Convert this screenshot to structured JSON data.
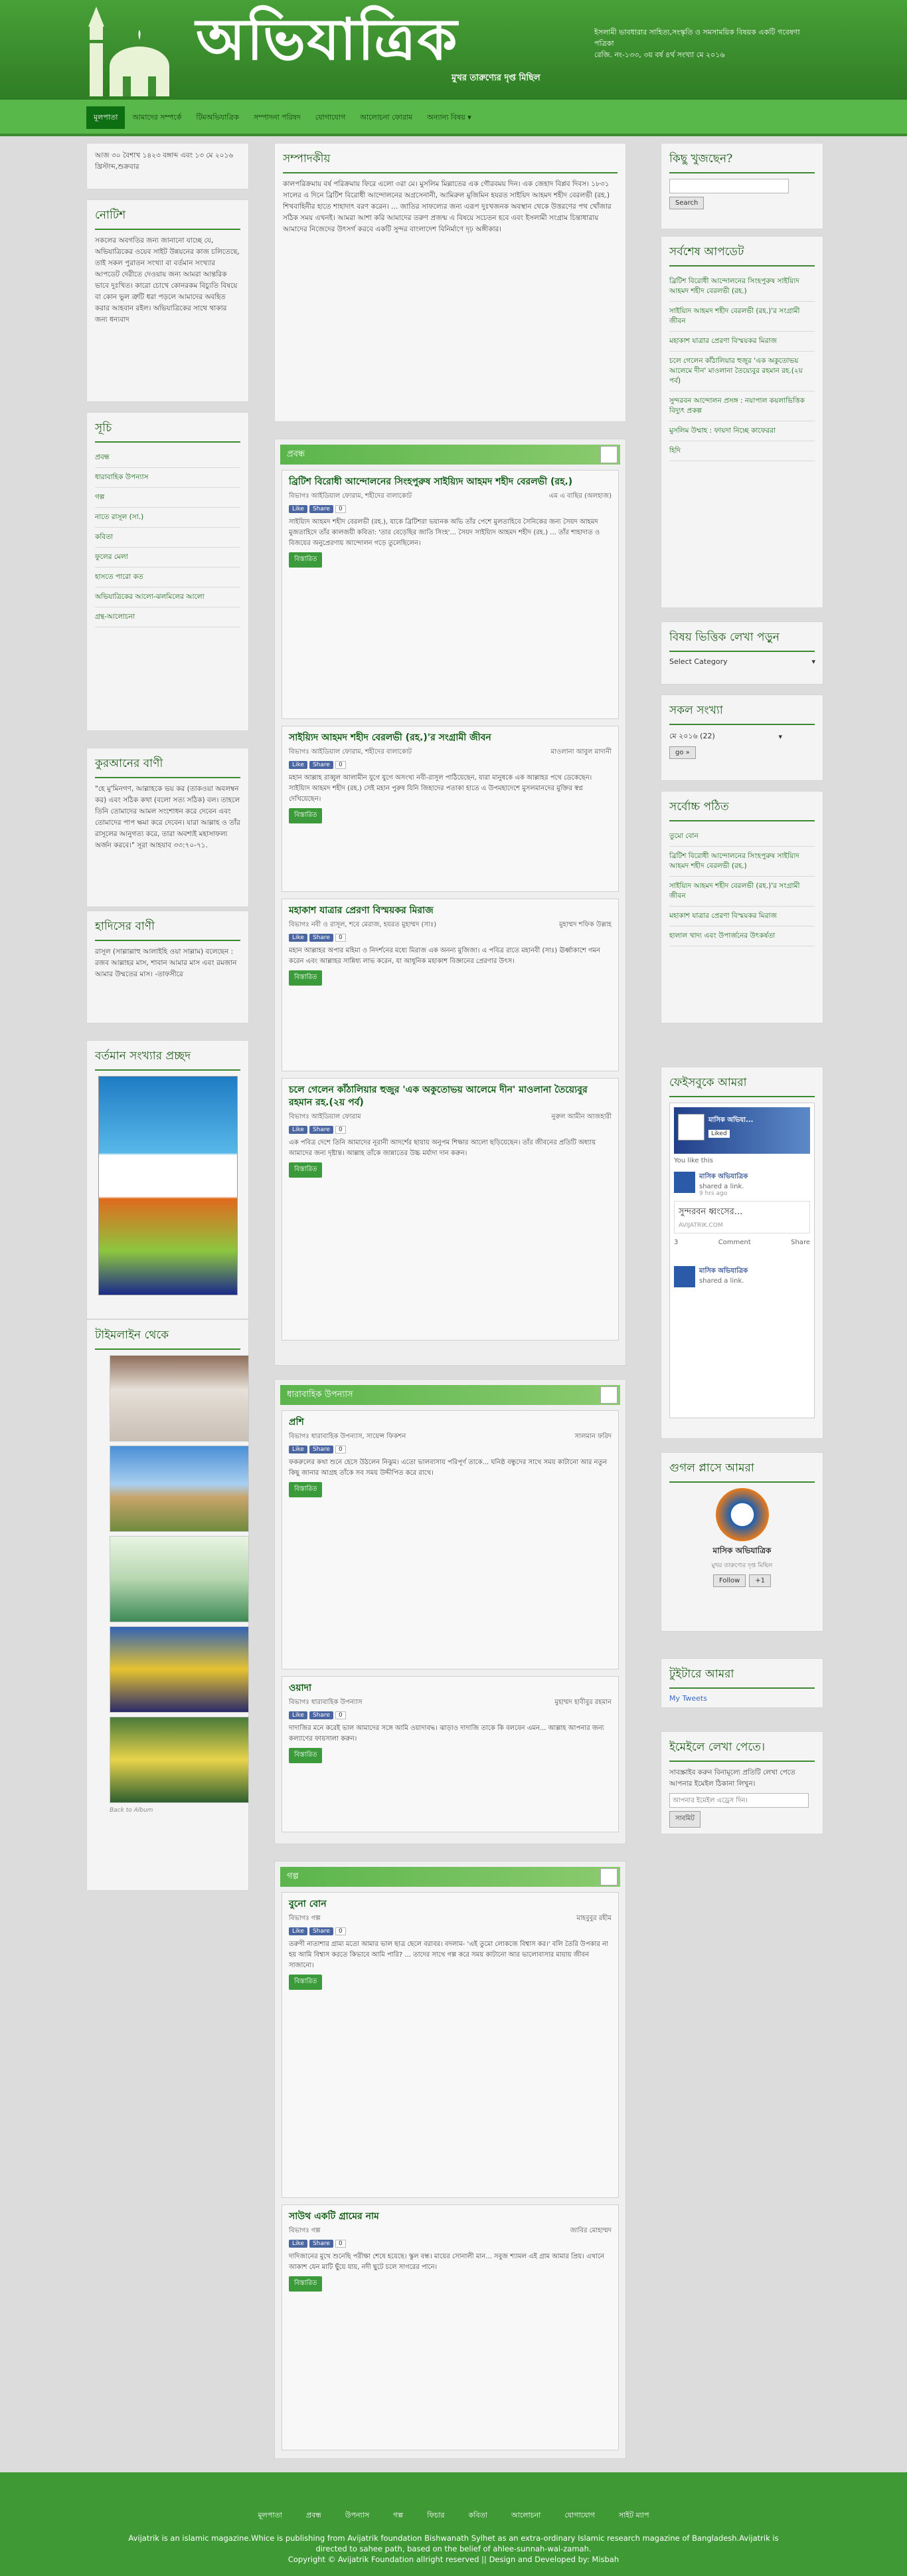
{
  "header": {
    "brand": "অভিযাত্রিক",
    "tagline": "মুখর তারুণ্যের দৃপ্ত মিছিল",
    "description": "ইসলামী ভাবধারার সাহিত্য,সংস্কৃতি ও সমসাময়িক বিষয়ক একটি গবেষণা পত্রিকা",
    "issue": "রেজি. নং-১৩৩, ৩য় বর্ষ ৪র্থ সংখ্যা মে ২০১৬"
  },
  "nav": {
    "items": [
      "মূলপাতা",
      "আমাদের সম্পর্কে",
      "টিমঅভিযাত্রিক",
      "সম্পাদনা পরিষদ",
      "যোগাযোগ",
      "আলোচনা ফোরাম",
      "অন্যান্য বিষয় ▾"
    ]
  },
  "left": {
    "date": "আজ ৩০ বৈশাখ ১৪২৩ বঙ্গাব্দ এবং ১৩ মে ২০১৬ খ্রিস্টাব্দ,শুক্রবার",
    "notice_title": "নোটিশ",
    "notice_text": "সকলের অবগতির জন্য জানানো যাচ্ছে যে, অভিযাত্রিকের ওয়েব সাইট উন্নয়নের কাজ চলিতেছে, তাই সকল পুরাতন সংখ্যা বা বর্তমান সংখ্যার আপডেট দেরীতে দেওয়ায় জন্য আমরা আন্তরিক ভাবে দুঃখিত। কারো চোখে কোনরকম বিচ্যুতি বিষয়ে বা কোন ভুল ত্রুটি ধরা পড়লে আমাদের অবহিত করার আহবান রইল। অভিযাত্রিকের সাথে থাকার জন্য ধন্যবাদ",
    "index_title": "সূচি",
    "index_items": [
      "প্রবন্ধ",
      "ধারাবাহিক উপন্যাস",
      "গল্প",
      "নাতে রাসূল (সা.)",
      "কবিতা",
      "ফুলের মেলা",
      "হাসতে পারো কত",
      "অভিযাত্রিকের আলো-ঝলমিলের আলো",
      "গ্রন্থ-আলোচনা"
    ],
    "quran_title": "কুরআনের বাণী",
    "quran_text": "\"হে মু'মিনগণ, আল্লাহকে ভয় কর (তাকওয়া অবলম্বন কর) এবং সঠিক কথা (বলো সত্য সঠিক) বল। তাহলে তিনি তোমাদের আমল সংশোধন করে দেবেন এবং তোমাদের পাপ ক্ষমা করে দেবেন। যারা আল্লাহ ও তাঁর রাসূলের আনুগত্য করে, তারা অবশ্যই মহাসাফল্য অর্জন করবে।\" সূরা আহযাব ৩৩:৭০-৭১.",
    "hadith_title": "হাদিসের বাণী",
    "hadith_text": "রাসূল (সাল্লাল্লাহু আলাইহি ওয়া সাল্লাম) বলেছেন : রজব আল্লাহর মাস, শাবান আমার মাস এবং রমজান আমার উম্মতের মাস। -তাফসীরে",
    "current_title": "বর্তমান সংখ্যার প্রচ্ছদ",
    "timeline_title": "টাইমলাইন থেকে",
    "back_to_album": "Back to Album"
  },
  "main": {
    "editorial_title": "সম্পাদকীয়",
    "editorial_text": "কালপরিক্রমায় বর্ষ পরিক্রমায় ফিরে এলো ৩রা মে। মুসলিম মিল্লাতের এক গৌরবময় দিন। এক জেহাদ বিপ্লব দিবস। ১৮৩১ সালের এ দিনে ব্রিটিশ বিরোধী আন্দোলনের অগ্রসেনানী, আমিরুল মুজিমিন হযরত সাইয়িদ আহমদ শহীদ বেরলভী (রহ.) শিখবাহিনীর হাতে শাহাদাৎ বরণ করেন। ... জাতির সাফল্যের জন্য এরূপ দুঃখজনক অবস্থান থেকে উত্তরণের পথ খোঁজার সঠিক সময় এখনই। আমরা আশা করি আমাদের তরুণ প্রজন্ম এ বিষয়ে সচেতন হবে এবং ইসলামী সংগ্রাম চিন্তাধারায় আমাদের নিজেদের উৎসর্গ করবে একটি সুন্দর বাংলাদেশ বিনির্মাণে দৃঢ় অঙ্গীকার।",
    "sections": [
      {
        "title": "প্রবন্ধ",
        "posts": [
          {
            "title": "ব্রিটিশ বিরোধী আন্দোলনের সিংহপুরুষ সাইয়্যিদ আহমদ শহীদ বেরলভী (রহ.)",
            "category": "বিভাগঃ আইডিয়াল ফোরাম, শহীদের বালাকোট",
            "author": "এম এ বাছির (অলহাজ)",
            "likes": "0",
            "excerpt": "সাইয়্যিদ আহমদ শহীদ বেরলভী (রহ.), যাকে ব্রিটিশরা ভয়ানক অভি তাঁর পেশে মুলতাহিবে সৈনিকের জন্য সৈয়দ আহমদ মুজতাহিদে তাঁর কালজয়ী কবিতা: 'তার বেড়েছির জাতি সিংহ'... সৈয়দ সাইয়্যিদ আহমদ শহীদ (রহ.) ... তাঁর শাহাদাত ও বিজয়ের অনুপ্রেরণায় আন্দোলন গড়ে তুলেছিলেন।",
            "more": "বিস্তারিত"
          },
          {
            "title": "সাইয়্যিদ আহমদ শহীদ বেরলভী (রহ.)'র সংগ্রামী জীবন",
            "category": "বিভাগঃ আইডিয়াল ফোরাম, শহীদের বালাকোট",
            "author": "মাওলানা আবুল মাদানী",
            "likes": "0",
            "excerpt": "মহান আল্লাহ রাব্বুল আলামীন যুগে যুগে অসংখ্য নবী-রাসূল পাঠিয়েছেন, যারা মানুষকে এক আল্লাহর পথে ডেকেছেন। সাইয়্যিদ আহমদ শহীদ (রহ.) সেই মহান পুরুষ যিনি জিহাদের পতাকা হাতে এ উপমহাদেশে মুসলমানদের মুক্তির স্বপ্ন দেখিয়েছেন।",
            "more": "বিস্তারিত"
          },
          {
            "title": "মহাকাশ যাত্রার প্রেরণা বিস্ময়কর মিরাজ",
            "category": "বিভাগঃ নবী ও রাসূল, শবে মেরাজ, হযরত মুহাম্মদ (সাঃ)",
            "author": "মুহাম্মদ শফিক উল্লাহ",
            "likes": "0",
            "excerpt": "মহান আল্লাহর অপার মহিমা ও নিদর্শনের মধ্যে মিরাজ এক অনন্য মুজিজা। এ পবিত্র রাতে মহানবী (সাঃ) ঊর্ধ্বাকাশে গমন করেন এবং আল্লাহর সান্নিধ্য লাভ করেন, যা আধুনিক মহাকাশ বিজ্ঞানের প্রেরণার উৎস।",
            "more": "বিস্তারিত"
          },
          {
            "title": "চলে গেলেন কাঁঠালিয়ার হুজুর 'এক অকুতোভয় আলেমে দীন' মাওলানা তৈয়্যেবুর রহমান রহ.(২য় পর্ব)",
            "category": "বিভাগঃ আইডিয়াল ফোরাম",
            "author": "নুরুল আমীন আজহারী",
            "likes": "0",
            "excerpt": "এক পবিত্র দেশে তিনি আমাদের নূরানী আদর্শের ছায়ায় অনুপম শিক্ষার আলো ছড়িয়েছেন। তাঁর জীবনের প্রতিটি অধ্যায় আমাদের জন্য দৃষ্টান্ত। আল্লাহ তাঁকে জান্নাতের উচ্চ মর্যাদা দান করুন।",
            "more": "বিস্তারিত"
          }
        ]
      },
      {
        "title": "ধারাবাহিক উপন্যাস",
        "posts": [
          {
            "title": "প্রশি",
            "category": "বিভাগঃ ধারাবাহিক উপন্যাস, সায়েন্স ফিকশন",
            "author": "সালমান ফরিদ",
            "likes": "0",
            "excerpt": "ফকরুলের কথা শুনে হেসে উঠলেন নিঝুম। এতো ভালবাসায় পরিপূর্ণ তাকে... ঘনিষ্ঠ বন্ধুদের সাথে সময় কাটানো আর নতুন কিছু জানার আগ্রহ তাঁকে সব সময় উদ্দীপিত করে রাখে।",
            "more": "বিস্তারিত"
          },
          {
            "title": "ওয়াদা",
            "category": "বিভাগঃ ধারাবাহিক উপন্যাস",
            "author": "মুহাম্মদ হাবীবুর রহমান",
            "likes": "0",
            "excerpt": "দাদাজির মনে করেই ভাল আমাদের সঙ্গে আমি ওয়াদাবদ্ধ। ঝাড়াও দাদাজি তাকে কি বলবেন এমন... আল্লাহ আপনার জন্য কল্যাণের ফায়সালা করুন।",
            "more": "বিস্তারিত"
          }
        ]
      },
      {
        "title": "গল্প",
        "posts": [
          {
            "title": "বুনো বোন",
            "category": "বিভাগঃ গল্প",
            "author": "মাহবুবুর রহীম",
            "likes": "0",
            "excerpt": "তরুণী নাতাশার গ্রাম্য মতো আমার ভাল ছাত্র ছেলে বরাবর। বদলাম- 'এই তুমো লোকজে বিশ্বাস কর।' বলি তৈরি উপকার না হয় আমি বিশ্বাস করতে কিভাবে আমি পারি? ... তাদের সাথে গল্প করে সময় কাটানো আর ভালোবাসার মায়ায় জীবন সাজানো।",
            "more": "বিস্তারিত"
          },
          {
            "title": "সাউথ একটি গ্রামের নাম",
            "category": "বিভাগঃ গল্প",
            "author": "জাবির মোহাম্মদ",
            "likes": "0",
            "excerpt": "দাদিজানের মুখে শুনেছি পরীক্ষা শেষে হয়েছে। স্কুল বন্ধ। মায়ের সোনালী মান... সবুজ শ্যামল এই গ্রাম আমার প্রিয়। এখানে আকাশ যেন মাটি ছুঁয়ে যায়, নদী ছুটে চলে সাগরের পানে।",
            "more": "বিস্তারিত"
          }
        ]
      }
    ]
  },
  "right": {
    "search_title": "কিছু খুজছেন?",
    "search_button": "Search",
    "recent_title": "সর্বশেষ আপডেট",
    "recent_items": [
      "ব্রিটিশ বিরোধী আন্দোলনের সিংহপুরুষ সাইয়্যিদ আহমদ শহীদ বেরলভী (রহ.)",
      "সাইয়্যিদ আহমদ শহীদ বেরলভী (রহ.)'র সংগ্রামী জীবন",
      "মহাকাশ যাত্রার প্রেরণা বিস্ময়কর মিরাজ",
      "চলে গেলেন কাঁঠালিয়ার হুজুর 'এক অকুতোভয় আলেমে দীন' মাওলানা তৈয়্যেবুর রহমান রহ.(২য় পর্ব)",
      "সুন্দরবন আন্দোলন প্রসঙ্গ : নয়াপাল কয়লাভিত্তিক বিদ্যুৎ প্রকল্প",
      "মুসলিম উম্মাহ : ফায়দা নিচ্ছে কাফেররা",
      "হিদি"
    ],
    "category_title": "বিষয় ভিত্তিক লেখা পড়ুন",
    "category_select": "Select Category",
    "archive_title": "সকল সংখ্যা",
    "archive_select": "মে ২০১৬ (22)",
    "archive_go": "go »",
    "popular_title": "সর্বোচ্চ পঠিত",
    "popular_items": [
      "তুমো বোন",
      "ব্রিটিশ বিরোধী আন্দোলনের সিংহপুরুষ সাইয়্যিদ আহমদ শহীদ বেরলভী (রহ.)",
      "সাইয়্যিদ আহমদ শহীদ বেরলভী (রহ.)'র সংগ্রামী জীবন",
      "মহাকাশ যাত্রার প্রেরণা বিস্ময়কর মিরাজ",
      "হালাল খাদ্য এবং উপার্জনের উৎকর্ষতা"
    ],
    "facebook_title": "ফেইসবুকে আমরা",
    "fb_page": "মাসিক অভিযা...",
    "fb_liked": "Liked",
    "fb_you_like": "You like this",
    "fb_post_name": "মাসিক অভিযাত্রিক",
    "fb_shared": "shared a link.",
    "fb_time": "9 hrs ago",
    "fb_link_title": "সুন্দরবন ধ্বংসের...",
    "fb_link_domain": "AVIJATRIK.COM",
    "fb_likes": "3",
    "fb_comment": "Comment",
    "fb_share": "Share",
    "gplus_title": "গুগল প্লাসে আমরা",
    "gplus_name": "মাসিক অভিযাত্রিক",
    "gplus_tag": "মুখর তারুণ্যের দৃপ্ত মিছিল",
    "gplus_follow": "Follow",
    "gplus_count": "+1",
    "twitter_title": "টুইটারে আমরা",
    "twitter_link": "My Tweets",
    "email_title": "ইমেইলে লেখা পেতে।",
    "email_text": "সাবস্ক্রাইব করুন বিনামূল্যে প্রতিটি লেখা পেতে আপনার ইমেইল ঠিকানা লিখুন।",
    "email_placeholder": "আপনার ইমেইল এড্রেস দিন।",
    "email_button": "সাবমিট"
  },
  "footer": {
    "links": [
      "মূলপাতা",
      "প্রবন্ধ",
      "উপন্যাস",
      "গল্প",
      "ফিচার",
      "কবিতা",
      "আলোচনা",
      "যোগাযোগ",
      "সাইট ম্যাপ"
    ],
    "line1": "Avijatrik is an islamic magazine.Whice is publishing from Avijatrik foundation Bishwanath Sylhet as an extra-ordinary Islamic research magazine of Bangladesh.Avijatrik is directed to sahee path, based on the belief of ahlee-sunnah-wal-zamah.",
    "line2": "Copyright © Avijatrik Foundation allright reserved || Design and Developed by: Misbah"
  },
  "colors": {
    "brand": "#3d8f2f",
    "nav": "#59b84a",
    "nav_active": "#0e6e12",
    "footer": "#3f9a36"
  }
}
